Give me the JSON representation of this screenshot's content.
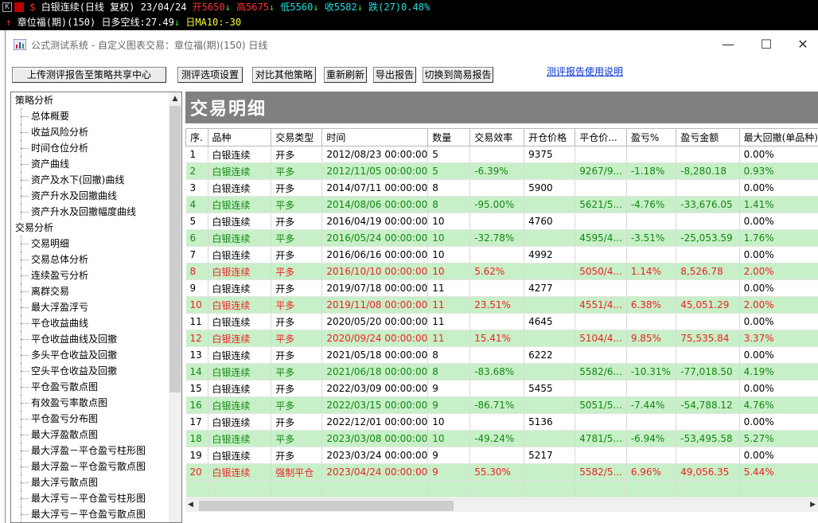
{
  "ticker": {
    "line1": {
      "name": "白银连续(日线 复权)",
      "date": "23/04/24",
      "open": "开5650",
      "high": "高5675",
      "low": "低5560",
      "close": "收5582",
      "change_label": "跌",
      "change": "(27)0.48%"
    },
    "line2": {
      "indicator": "章位福(期)(150)",
      "position": "日多空线:27.49",
      "ma_label": "日MA10:",
      "ma_value": "-30"
    }
  },
  "window": {
    "title": "公式测试系统 - 自定义图表交易：章位福(期)(150) 日线",
    "minimize": "—",
    "maximize": "☐",
    "close": "✕"
  },
  "toolbar": {
    "upload": "上传测评报告至策略共享中心",
    "options": "测评选项设置",
    "compare": "对比其他策略",
    "refresh": "重新刷新",
    "export": "导出报告",
    "simple": "切换到简易报告",
    "help_link": "测评报告使用说明"
  },
  "sidebar": {
    "groups": [
      {
        "label": "策略分析",
        "items": [
          "总体概要",
          "收益风险分析",
          "时间仓位分析",
          "资产曲线",
          "资产及水下(回撤)曲线",
          "资产升水及回撤曲线",
          "资产升水及回撤幅度曲线"
        ]
      },
      {
        "label": "交易分析",
        "items": [
          "交易明细",
          "交易总体分析",
          "连续盈亏分析",
          "离群交易",
          "最大浮盈浮亏",
          "平仓收益曲线",
          "平仓收益曲线及回撤",
          "多头平仓收益及回撤",
          "空头平仓收益及回撤",
          "平仓盈亏散点图",
          "有效盈亏率散点图",
          "平仓盈亏分布图",
          "最大浮盈散点图",
          "最大浮盈－平仓盈亏柱形图",
          "最大浮盈－平仓盈亏散点图",
          "最大浮亏散点图",
          "最大浮亏－平仓盈亏柱形图",
          "最大浮亏－平仓盈亏散点图"
        ]
      }
    ]
  },
  "main": {
    "header": "交易明细",
    "columns": [
      "序.",
      "品种",
      "交易类型",
      "时间",
      "数量",
      "交易效率",
      "开仓价格",
      "平仓价...",
      "盈亏%",
      "盈亏金额",
      "最大回撤(单品种)"
    ],
    "rows": [
      {
        "kind": "open",
        "cells": [
          "1",
          "白银连续",
          "开多",
          "2012/08/23 00:00:00",
          "5",
          "",
          "9375",
          "",
          "",
          "",
          "0.00%"
        ]
      },
      {
        "kind": "close loss",
        "cells": [
          "2",
          "白银连续",
          "平多",
          "2012/11/05 00:00:00",
          "5",
          "-6.39%",
          "",
          "9267/9...",
          "-1.18%",
          "-8,280.18",
          "0.93%"
        ]
      },
      {
        "kind": "open",
        "cells": [
          "3",
          "白银连续",
          "开多",
          "2014/07/11 00:00:00",
          "8",
          "",
          "5900",
          "",
          "",
          "",
          "0.00%"
        ]
      },
      {
        "kind": "close loss",
        "cells": [
          "4",
          "白银连续",
          "平多",
          "2014/08/06 00:00:00",
          "8",
          "-95.00%",
          "",
          "5621/5...",
          "-4.76%",
          "-33,676.05",
          "1.41%"
        ]
      },
      {
        "kind": "open",
        "cells": [
          "5",
          "白银连续",
          "开多",
          "2016/04/19 00:00:00",
          "10",
          "",
          "4760",
          "",
          "",
          "",
          "0.00%"
        ]
      },
      {
        "kind": "close loss",
        "cells": [
          "6",
          "白银连续",
          "平多",
          "2016/05/24 00:00:00",
          "10",
          "-32.78%",
          "",
          "4595/4...",
          "-3.51%",
          "-25,053.59",
          "1.76%"
        ]
      },
      {
        "kind": "open",
        "cells": [
          "7",
          "白银连续",
          "开多",
          "2016/06/16 00:00:00",
          "10",
          "",
          "4992",
          "",
          "",
          "",
          "0.00%"
        ]
      },
      {
        "kind": "close gain",
        "cells": [
          "8",
          "白银连续",
          "平多",
          "2016/10/10 00:00:00",
          "10",
          "5.62%",
          "",
          "5050/4...",
          "1.14%",
          "8,526.78",
          "2.00%"
        ]
      },
      {
        "kind": "open",
        "cells": [
          "9",
          "白银连续",
          "开多",
          "2019/07/18 00:00:00",
          "11",
          "",
          "4277",
          "",
          "",
          "",
          "0.00%"
        ]
      },
      {
        "kind": "close gain",
        "cells": [
          "10",
          "白银连续",
          "平多",
          "2019/11/08 00:00:00",
          "11",
          "23.51%",
          "",
          "4551/4...",
          "6.38%",
          "45,051.29",
          "2.00%"
        ]
      },
      {
        "kind": "open",
        "cells": [
          "11",
          "白银连续",
          "开多",
          "2020/05/20 00:00:00",
          "11",
          "",
          "4645",
          "",
          "",
          "",
          "0.00%"
        ]
      },
      {
        "kind": "close gain",
        "cells": [
          "12",
          "白银连续",
          "平多",
          "2020/09/24 00:00:00",
          "11",
          "15.41%",
          "",
          "5104/4...",
          "9.85%",
          "75,535.84",
          "3.37%"
        ]
      },
      {
        "kind": "open",
        "cells": [
          "13",
          "白银连续",
          "开多",
          "2021/05/18 00:00:00",
          "8",
          "",
          "6222",
          "",
          "",
          "",
          "0.00%"
        ]
      },
      {
        "kind": "close loss",
        "cells": [
          "14",
          "白银连续",
          "平多",
          "2021/06/18 00:00:00",
          "8",
          "-83.68%",
          "",
          "5582/6...",
          "-10.31%",
          "-77,018.50",
          "4.19%"
        ]
      },
      {
        "kind": "open",
        "cells": [
          "15",
          "白银连续",
          "开多",
          "2022/03/09 00:00:00",
          "9",
          "",
          "5455",
          "",
          "",
          "",
          "0.00%"
        ]
      },
      {
        "kind": "close loss",
        "cells": [
          "16",
          "白银连续",
          "平多",
          "2022/03/15 00:00:00",
          "9",
          "-86.71%",
          "",
          "5051/5...",
          "-7.44%",
          "-54,788.12",
          "4.76%"
        ]
      },
      {
        "kind": "open",
        "cells": [
          "17",
          "白银连续",
          "开多",
          "2022/12/01 00:00:00",
          "10",
          "",
          "5136",
          "",
          "",
          "",
          "0.00%"
        ]
      },
      {
        "kind": "close loss",
        "cells": [
          "18",
          "白银连续",
          "平多",
          "2023/03/08 00:00:00",
          "10",
          "-49.24%",
          "",
          "4781/5...",
          "-6.94%",
          "-53,495.58",
          "5.27%"
        ]
      },
      {
        "kind": "open",
        "cells": [
          "19",
          "白银连续",
          "开多",
          "2023/03/24 00:00:00",
          "9",
          "",
          "5217",
          "",
          "",
          "",
          "0.00%"
        ]
      },
      {
        "kind": "close gain",
        "cells": [
          "20",
          "白银连续",
          "强制平仓",
          "2023/04/24 00:00:00",
          "9",
          "55.30%",
          "",
          "5582/5...",
          "6.96%",
          "49,056.35",
          "5.44%"
        ]
      }
    ]
  }
}
